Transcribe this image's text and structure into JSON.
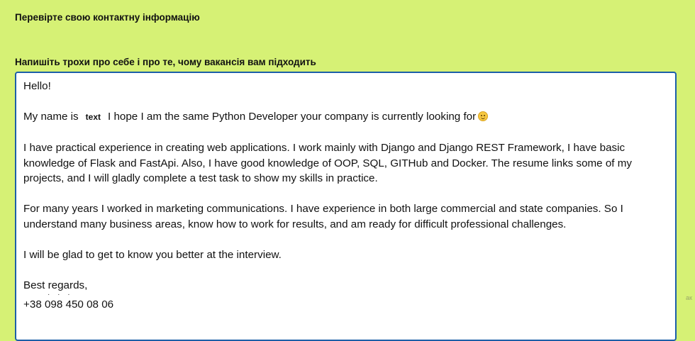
{
  "headings": {
    "contact": "Перевірте свою контактну інформацію",
    "about": "Напишіть трохи про себе і про те, чому вакансія вам підходить"
  },
  "letter": {
    "greeting": "Hello!",
    "intro_prefix": "My name is",
    "name_placeholder": "text",
    "intro_suffix": "I hope I am the same Python Developer your company is currently looking for",
    "para_experience": "I have practical experience in creating web applications. I work mainly with Django and Django REST Framework, I have basic knowledge of Flask and FastApi. Also, I have good knowledge of OOP, SQL, GITHub and Docker. The resume links some of my projects, and I will gladly complete a test task to show my skills in practice.",
    "para_marketing": "For many years I worked in marketing communications. I have experience in both large commercial and state companies. So I understand many business areas, know how to work for results, and am ready for difficult professional challenges.",
    "para_interview": "I will be glad to get to know you better at the interview.",
    "closing": "Best regards,",
    "phone": "+38 098 450 08 06"
  },
  "resize_hint": "ак",
  "colors": {
    "page_bg": "#d6f175",
    "textarea_border": "#1c5fa8",
    "emoji": "#f7c841"
  },
  "icons": {
    "smile": "slightly-smiling-face-icon"
  }
}
